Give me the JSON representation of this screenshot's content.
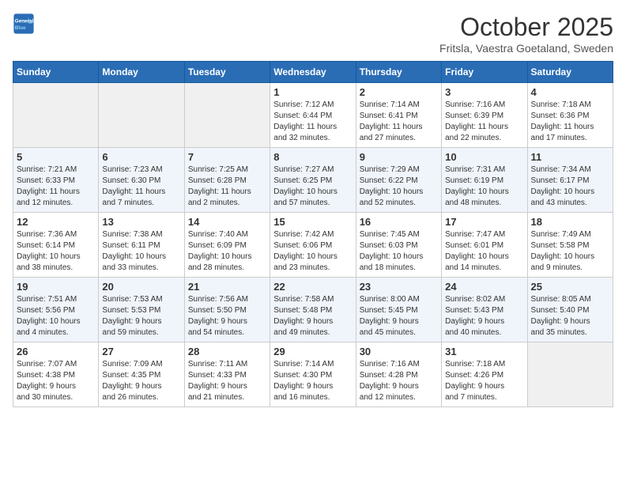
{
  "header": {
    "logo_line1": "General",
    "logo_line2": "Blue",
    "month_year": "October 2025",
    "location": "Fritsla, Vaestra Goetaland, Sweden"
  },
  "days_of_week": [
    "Sunday",
    "Monday",
    "Tuesday",
    "Wednesday",
    "Thursday",
    "Friday",
    "Saturday"
  ],
  "weeks": [
    [
      {
        "day": "",
        "info": ""
      },
      {
        "day": "",
        "info": ""
      },
      {
        "day": "",
        "info": ""
      },
      {
        "day": "1",
        "info": "Sunrise: 7:12 AM\nSunset: 6:44 PM\nDaylight: 11 hours\nand 32 minutes."
      },
      {
        "day": "2",
        "info": "Sunrise: 7:14 AM\nSunset: 6:41 PM\nDaylight: 11 hours\nand 27 minutes."
      },
      {
        "day": "3",
        "info": "Sunrise: 7:16 AM\nSunset: 6:39 PM\nDaylight: 11 hours\nand 22 minutes."
      },
      {
        "day": "4",
        "info": "Sunrise: 7:18 AM\nSunset: 6:36 PM\nDaylight: 11 hours\nand 17 minutes."
      }
    ],
    [
      {
        "day": "5",
        "info": "Sunrise: 7:21 AM\nSunset: 6:33 PM\nDaylight: 11 hours\nand 12 minutes."
      },
      {
        "day": "6",
        "info": "Sunrise: 7:23 AM\nSunset: 6:30 PM\nDaylight: 11 hours\nand 7 minutes."
      },
      {
        "day": "7",
        "info": "Sunrise: 7:25 AM\nSunset: 6:28 PM\nDaylight: 11 hours\nand 2 minutes."
      },
      {
        "day": "8",
        "info": "Sunrise: 7:27 AM\nSunset: 6:25 PM\nDaylight: 10 hours\nand 57 minutes."
      },
      {
        "day": "9",
        "info": "Sunrise: 7:29 AM\nSunset: 6:22 PM\nDaylight: 10 hours\nand 52 minutes."
      },
      {
        "day": "10",
        "info": "Sunrise: 7:31 AM\nSunset: 6:19 PM\nDaylight: 10 hours\nand 48 minutes."
      },
      {
        "day": "11",
        "info": "Sunrise: 7:34 AM\nSunset: 6:17 PM\nDaylight: 10 hours\nand 43 minutes."
      }
    ],
    [
      {
        "day": "12",
        "info": "Sunrise: 7:36 AM\nSunset: 6:14 PM\nDaylight: 10 hours\nand 38 minutes."
      },
      {
        "day": "13",
        "info": "Sunrise: 7:38 AM\nSunset: 6:11 PM\nDaylight: 10 hours\nand 33 minutes."
      },
      {
        "day": "14",
        "info": "Sunrise: 7:40 AM\nSunset: 6:09 PM\nDaylight: 10 hours\nand 28 minutes."
      },
      {
        "day": "15",
        "info": "Sunrise: 7:42 AM\nSunset: 6:06 PM\nDaylight: 10 hours\nand 23 minutes."
      },
      {
        "day": "16",
        "info": "Sunrise: 7:45 AM\nSunset: 6:03 PM\nDaylight: 10 hours\nand 18 minutes."
      },
      {
        "day": "17",
        "info": "Sunrise: 7:47 AM\nSunset: 6:01 PM\nDaylight: 10 hours\nand 14 minutes."
      },
      {
        "day": "18",
        "info": "Sunrise: 7:49 AM\nSunset: 5:58 PM\nDaylight: 10 hours\nand 9 minutes."
      }
    ],
    [
      {
        "day": "19",
        "info": "Sunrise: 7:51 AM\nSunset: 5:56 PM\nDaylight: 10 hours\nand 4 minutes."
      },
      {
        "day": "20",
        "info": "Sunrise: 7:53 AM\nSunset: 5:53 PM\nDaylight: 9 hours\nand 59 minutes."
      },
      {
        "day": "21",
        "info": "Sunrise: 7:56 AM\nSunset: 5:50 PM\nDaylight: 9 hours\nand 54 minutes."
      },
      {
        "day": "22",
        "info": "Sunrise: 7:58 AM\nSunset: 5:48 PM\nDaylight: 9 hours\nand 49 minutes."
      },
      {
        "day": "23",
        "info": "Sunrise: 8:00 AM\nSunset: 5:45 PM\nDaylight: 9 hours\nand 45 minutes."
      },
      {
        "day": "24",
        "info": "Sunrise: 8:02 AM\nSunset: 5:43 PM\nDaylight: 9 hours\nand 40 minutes."
      },
      {
        "day": "25",
        "info": "Sunrise: 8:05 AM\nSunset: 5:40 PM\nDaylight: 9 hours\nand 35 minutes."
      }
    ],
    [
      {
        "day": "26",
        "info": "Sunrise: 7:07 AM\nSunset: 4:38 PM\nDaylight: 9 hours\nand 30 minutes."
      },
      {
        "day": "27",
        "info": "Sunrise: 7:09 AM\nSunset: 4:35 PM\nDaylight: 9 hours\nand 26 minutes."
      },
      {
        "day": "28",
        "info": "Sunrise: 7:11 AM\nSunset: 4:33 PM\nDaylight: 9 hours\nand 21 minutes."
      },
      {
        "day": "29",
        "info": "Sunrise: 7:14 AM\nSunset: 4:30 PM\nDaylight: 9 hours\nand 16 minutes."
      },
      {
        "day": "30",
        "info": "Sunrise: 7:16 AM\nSunset: 4:28 PM\nDaylight: 9 hours\nand 12 minutes."
      },
      {
        "day": "31",
        "info": "Sunrise: 7:18 AM\nSunset: 4:26 PM\nDaylight: 9 hours\nand 7 minutes."
      },
      {
        "day": "",
        "info": ""
      }
    ]
  ]
}
